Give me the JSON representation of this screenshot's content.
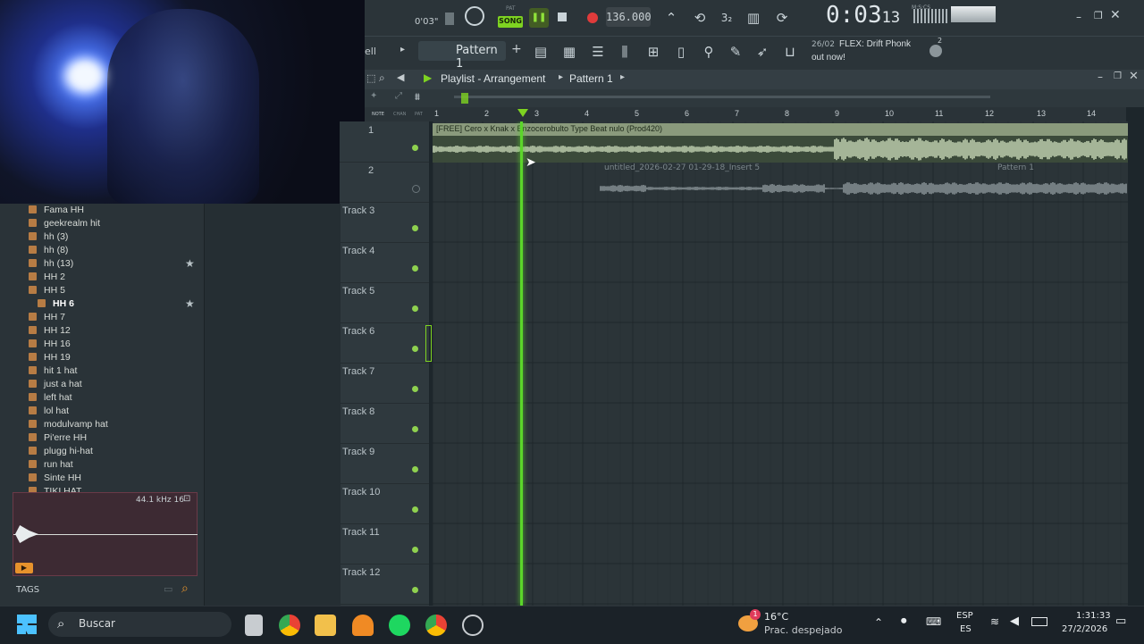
{
  "transport": {
    "small_time": "0'03\"",
    "song_label": "SONG",
    "pat_label": "PAT",
    "tempo": "136.000",
    "main_time": "0:03",
    "main_time_sub": "13",
    "mcs_label": "M:S:CS"
  },
  "toolbar2": {
    "cut_label": "ell",
    "pattern_name": "Pattern 1",
    "news_date": "26/02",
    "news_text": "FLEX: Drift Phonk",
    "news_text2": "out now!",
    "news_badge": "2"
  },
  "playlist": {
    "title": "Playlist - Arrangement",
    "pattern": "Pattern 1",
    "ruler": [
      "1",
      "2",
      "3",
      "4",
      "5",
      "6",
      "7",
      "8",
      "9",
      "10",
      "11",
      "12",
      "13",
      "14"
    ],
    "ruler_left": [
      "NOTE",
      "CHAN",
      "PAT"
    ],
    "clip1_title": "[FREE] Cero x Knak x Enzocerobulto  Type Beat  nulo  (Prod420)",
    "clip2_title": "untitled_2026-02-27 01-29-18_Insert 5",
    "clip2b_title": "Pattern 1",
    "tracks": [
      {
        "name": "1"
      },
      {
        "name": "2"
      },
      {
        "name": "Track 3"
      },
      {
        "name": "Track 4"
      },
      {
        "name": "Track 5"
      },
      {
        "name": "Track 6"
      },
      {
        "name": "Track 7"
      },
      {
        "name": "Track 8"
      },
      {
        "name": "Track 9"
      },
      {
        "name": "Track 10"
      },
      {
        "name": "Track 11"
      },
      {
        "name": "Track 12"
      }
    ]
  },
  "browser": {
    "items": [
      "Fama HH",
      "geekrealm hit",
      "hh (3)",
      "hh (8)",
      "hh (13)",
      "HH 2",
      "HH 5",
      "HH 6",
      "HH 7",
      "HH 12",
      "HH 16",
      "HH 19",
      "hit 1 hat",
      "just a hat",
      "left hat",
      "lol hat",
      "modulvamp hat",
      "Pi'erre  HH",
      "plugg hi-hat",
      "run hat",
      "Sinte HH",
      "TIKI HAT"
    ],
    "starred": [
      "hh (13)",
      "HH 6"
    ],
    "sample_rate": "44.1 kHz 16",
    "tags_label": "TAGS"
  },
  "taskbar": {
    "search_placeholder": "Buscar",
    "weather_temp": "16°C",
    "weather_desc": "Prac. despejado",
    "weather_badge": "1",
    "lang1": "ESP",
    "lang2": "ES",
    "time": "1:31:33",
    "date": "27/2/2026"
  },
  "colors": {
    "accent_green": "#7ed321",
    "playhead": "#5bd62a",
    "record": "#e03b3b",
    "clip_header": "#8a9a7c",
    "waveform": "#c9d9b8"
  }
}
